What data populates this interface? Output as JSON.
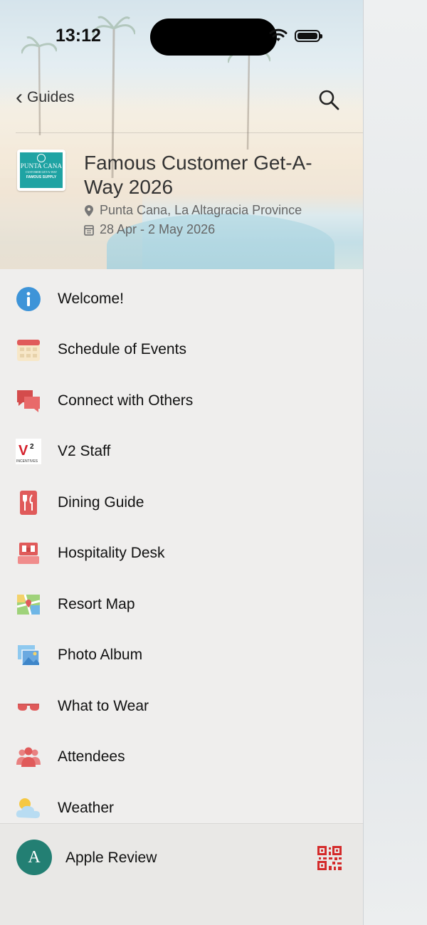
{
  "status": {
    "time": "13:12"
  },
  "nav": {
    "back_label": "Guides"
  },
  "event": {
    "title": "Famous Customer Get-A-Way 2026",
    "location": "Punta Cana, La Altagracia Province",
    "dates": "28 Apr - 2 May 2026",
    "logo": {
      "line1": "PUNTA CANA",
      "line2": "CUSTOMER GET-A-WAY",
      "line3": "FAMOUS SUPPLY"
    }
  },
  "menu": [
    {
      "label": "Welcome!",
      "icon": "info-icon"
    },
    {
      "label": "Schedule of Events",
      "icon": "calendar-icon"
    },
    {
      "label": "Connect with Others",
      "icon": "chat-bubbles-icon"
    },
    {
      "label": "V2 Staff",
      "icon": "v2-incentives-logo-icon"
    },
    {
      "label": "Dining Guide",
      "icon": "fork-knife-icon"
    },
    {
      "label": "Hospitality Desk",
      "icon": "desk-icon"
    },
    {
      "label": "Resort Map",
      "icon": "map-icon"
    },
    {
      "label": "Photo Album",
      "icon": "photos-icon"
    },
    {
      "label": "What to Wear",
      "icon": "sunglasses-icon"
    },
    {
      "label": "Attendees",
      "icon": "people-icon"
    },
    {
      "label": "Weather",
      "icon": "sun-cloud-icon"
    }
  ],
  "user": {
    "initial": "A",
    "name": "Apple Review"
  },
  "colors": {
    "accent_red": "#e05a5a",
    "info_blue": "#3e94d8",
    "avatar_green": "#237f73",
    "qr_red": "#d42b2b"
  }
}
